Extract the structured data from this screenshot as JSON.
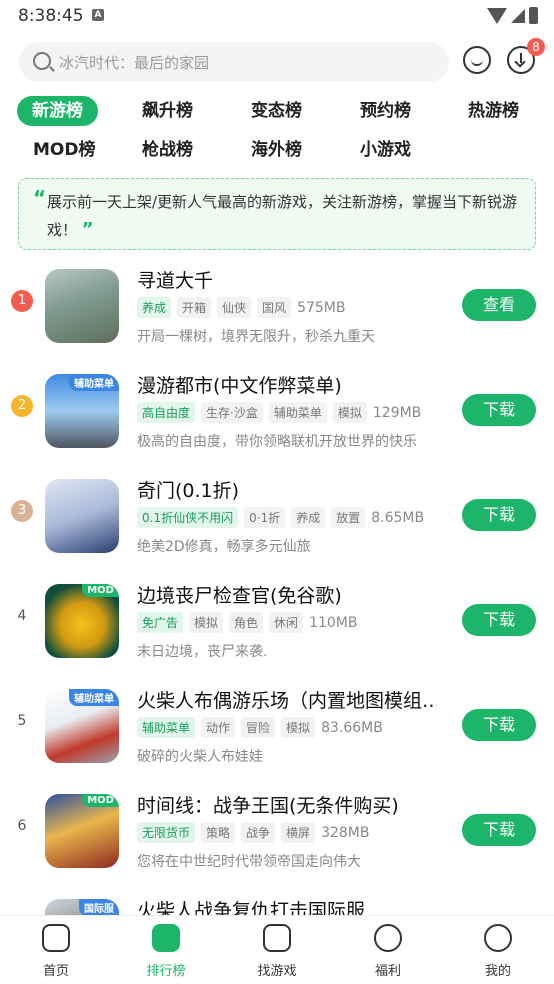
{
  "status_bar": {
    "time": "8:38:45"
  },
  "search": {
    "placeholder": "冰汽时代：最后的家园"
  },
  "download_badge": "8",
  "tabs": [
    "新游榜",
    "飙升榜",
    "变态榜",
    "预约榜",
    "热游榜",
    "MOD榜",
    "枪战榜",
    "海外榜",
    "小游戏"
  ],
  "active_tab": "新游榜",
  "notice": {
    "text": "展示前一天上架/更新人气最高的新游戏，关注新游榜，掌握当下新锐游戏！"
  },
  "games": [
    {
      "rank": "1",
      "title": "寻道大千",
      "tags": [
        "养成",
        "开箱",
        "仙侠",
        "国风"
      ],
      "size": "575MB",
      "desc": "开局一棵树，境界无限升，秒杀九重天",
      "button": "查看",
      "corner": ""
    },
    {
      "rank": "2",
      "title": "漫游都市(中文作弊菜单)",
      "tags": [
        "高自由度",
        "生存·沙盒",
        "辅助菜单",
        "模拟"
      ],
      "size": "129MB",
      "desc": "极高的自由度，带你领略联机开放世界的快乐",
      "button": "下载",
      "corner": "辅助菜单"
    },
    {
      "rank": "3",
      "title": "奇门(0.1折)",
      "tags": [
        "0.1折仙侠不用闪",
        "0·1折",
        "养成",
        "放置"
      ],
      "size": "8.65MB",
      "desc": "绝美2D修真，畅享多元仙旅",
      "button": "下载",
      "corner": ""
    },
    {
      "rank": "4",
      "title": "边境丧尸检查官(免谷歌)",
      "tags": [
        "免广告",
        "模拟",
        "角色",
        "休闲"
      ],
      "size": "110MB",
      "desc": "末日边境，丧尸来袭.",
      "button": "下载",
      "corner": "MOD"
    },
    {
      "rank": "5",
      "title": "火柴人布偶游乐场（内置地图模组…",
      "tags": [
        "辅助菜单",
        "动作",
        "冒险",
        "模拟"
      ],
      "size": "83.66MB",
      "desc": "破碎的火柴人布娃娃",
      "button": "下载",
      "corner": "辅助菜单"
    },
    {
      "rank": "6",
      "title": "时间线：战争王国(无条件购买)",
      "tags": [
        "无限货币",
        "策略",
        "战争",
        "横屏"
      ],
      "size": "328MB",
      "desc": "您将在中世纪时代带领帝国走向伟大",
      "button": "下载",
      "corner": "MOD"
    },
    {
      "rank": "7",
      "title": "火柴人战争复仇打击国际服",
      "tags": [],
      "size": "",
      "desc": "",
      "button": "",
      "corner": "国际服"
    }
  ],
  "bottom_nav": [
    "首页",
    "排行榜",
    "找游戏",
    "福利",
    "我的"
  ],
  "colors": {
    "accent": "#1db56a",
    "rank1": "#f25c4f",
    "rank2": "#f7b52c",
    "rank3": "#d8b295"
  }
}
